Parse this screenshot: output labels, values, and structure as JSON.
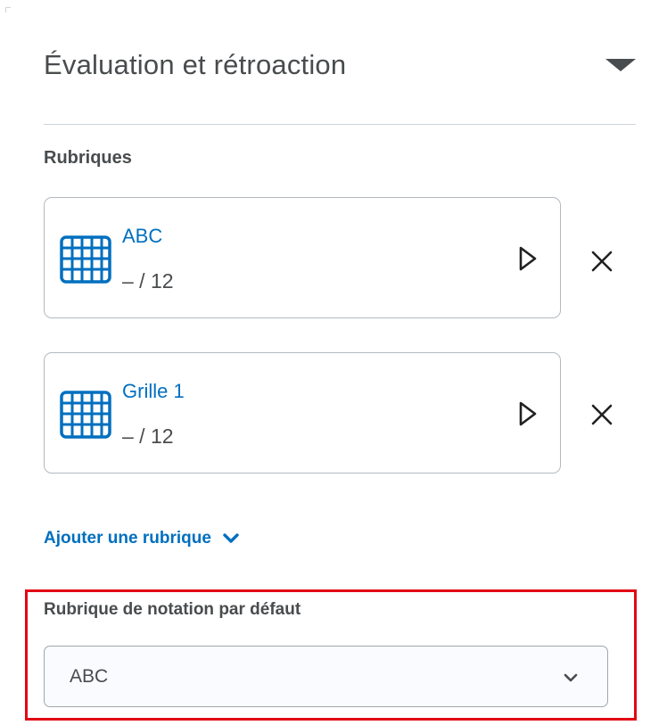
{
  "panel": {
    "title": "Évaluation et rétroaction",
    "toggle_icon": "caret-down-icon"
  },
  "rubrics": {
    "label": "Rubriques",
    "items": [
      {
        "name": "ABC",
        "score": "– / 12",
        "icon": "rubric-grid-icon"
      },
      {
        "name": "Grille 1",
        "score": "– / 12",
        "icon": "rubric-grid-icon"
      }
    ],
    "add_label": "Ajouter une rubrique",
    "add_icon": "chevron-down-icon"
  },
  "default_rubric": {
    "label": "Rubrique de notation par défaut",
    "selected": "ABC"
  },
  "colors": {
    "link": "#006fbf",
    "text": "#494c4e",
    "highlight": "#e30613",
    "border": "#b3b9bf"
  }
}
